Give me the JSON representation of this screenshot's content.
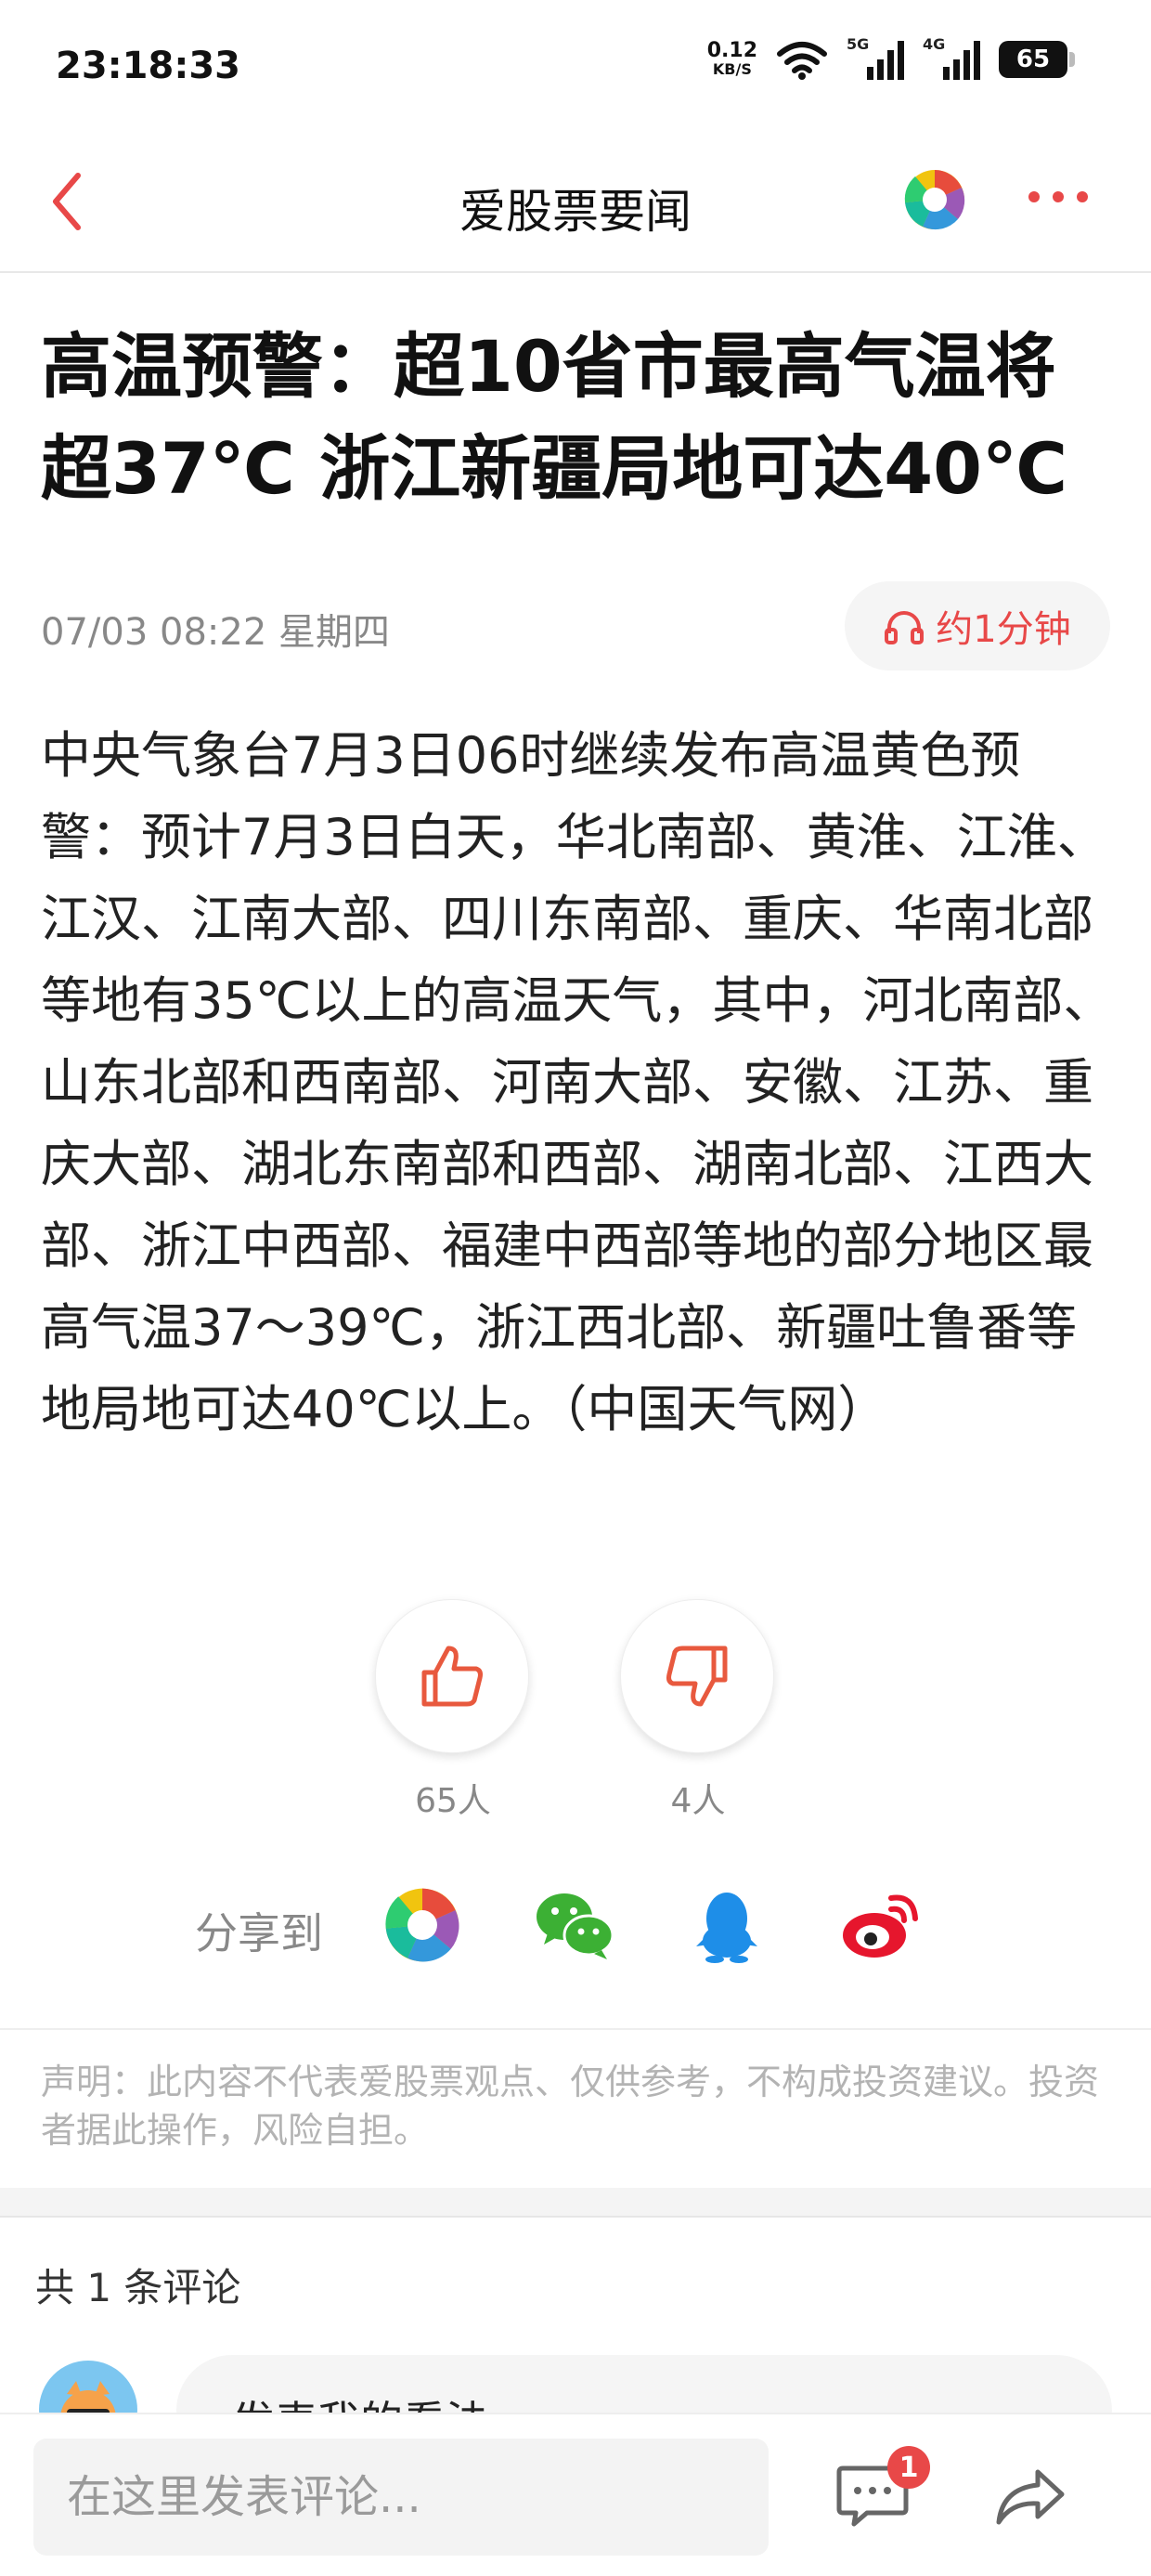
{
  "status": {
    "time": "23:18:33",
    "speed_value": "0.12",
    "speed_unit": "KB/S",
    "sim1": "5G",
    "sim2": "4G",
    "battery": "65"
  },
  "nav": {
    "title": "爱股票要闻",
    "back_icon": "chevron-left-icon",
    "logo_icon": "app-logo-icon",
    "more_icon": "more-dots-icon"
  },
  "article": {
    "title": "高温预警：超10省市最高气温将超37℃ 浙江新疆局地可达40℃",
    "date": "07/03 08:22 星期四",
    "listen_label": "约1分钟",
    "body": "中央气象台7月3日06时继续发布高温黄色预警：预计7月3日白天，华北南部、黄淮、江淮、江汉、江南大部、四川东南部、重庆、华南北部等地有35℃以上的高温天气，其中，河北南部、山东北部和西南部、河南大部、安徽、江苏、重庆大部、湖北东南部和西部、湖南北部、江西大部、浙江中西部、福建中西部等地的部分地区最高气温37～39℃，浙江西北部、新疆吐鲁番等地局地可达40℃以上。（中国天气网）"
  },
  "reactions": {
    "like_count": "65人",
    "dislike_count": "4人"
  },
  "share": {
    "label": "分享到"
  },
  "disclaimer": "声明：此内容不代表爱股票观点、仅供参考，不构成投资建议。投资者据此操作，风险自担。",
  "comments": {
    "count_label": "共 1 条评论",
    "prompt": "发表我的看法"
  },
  "bottom": {
    "input_placeholder": "在这里发表评论...",
    "badge_count": "1"
  },
  "colors": {
    "accent": "#e84848",
    "wechat": "#3cb034",
    "qq": "#1e8ee8",
    "weibo": "#e6162d"
  }
}
